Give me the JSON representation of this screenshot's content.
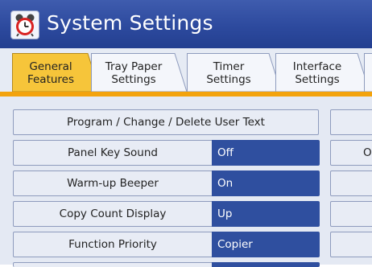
{
  "title": "System Settings",
  "tabs": [
    {
      "label_line1": "General",
      "label_line2": "Features",
      "selected": true
    },
    {
      "label_line1": "Tray Paper",
      "label_line2": "Settings",
      "selected": false
    },
    {
      "label_line1": "Timer",
      "label_line2": "Settings",
      "selected": false
    },
    {
      "label_line1": "Interface",
      "label_line2": "Settings",
      "selected": false
    }
  ],
  "settings": [
    {
      "label": "Program / Change / Delete User Text",
      "value": ""
    },
    {
      "label": "Panel Key Sound",
      "value": "Off"
    },
    {
      "label": "Warm-up Beeper",
      "value": "On"
    },
    {
      "label": "Copy Count Display",
      "value": "Up"
    },
    {
      "label": "Function Priority",
      "value": "Copier"
    }
  ],
  "right_column": [
    {
      "label": ""
    },
    {
      "label": "O"
    },
    {
      "label": ""
    },
    {
      "label": ""
    },
    {
      "label": ""
    }
  ],
  "colors": {
    "title_bar": "#2d4a9e",
    "selected_tab": "#f6c53a",
    "tab_underline": "#f3a30d",
    "value_field": "#2f4f9f"
  },
  "icons": {
    "title": "alarm-clock-icon"
  }
}
